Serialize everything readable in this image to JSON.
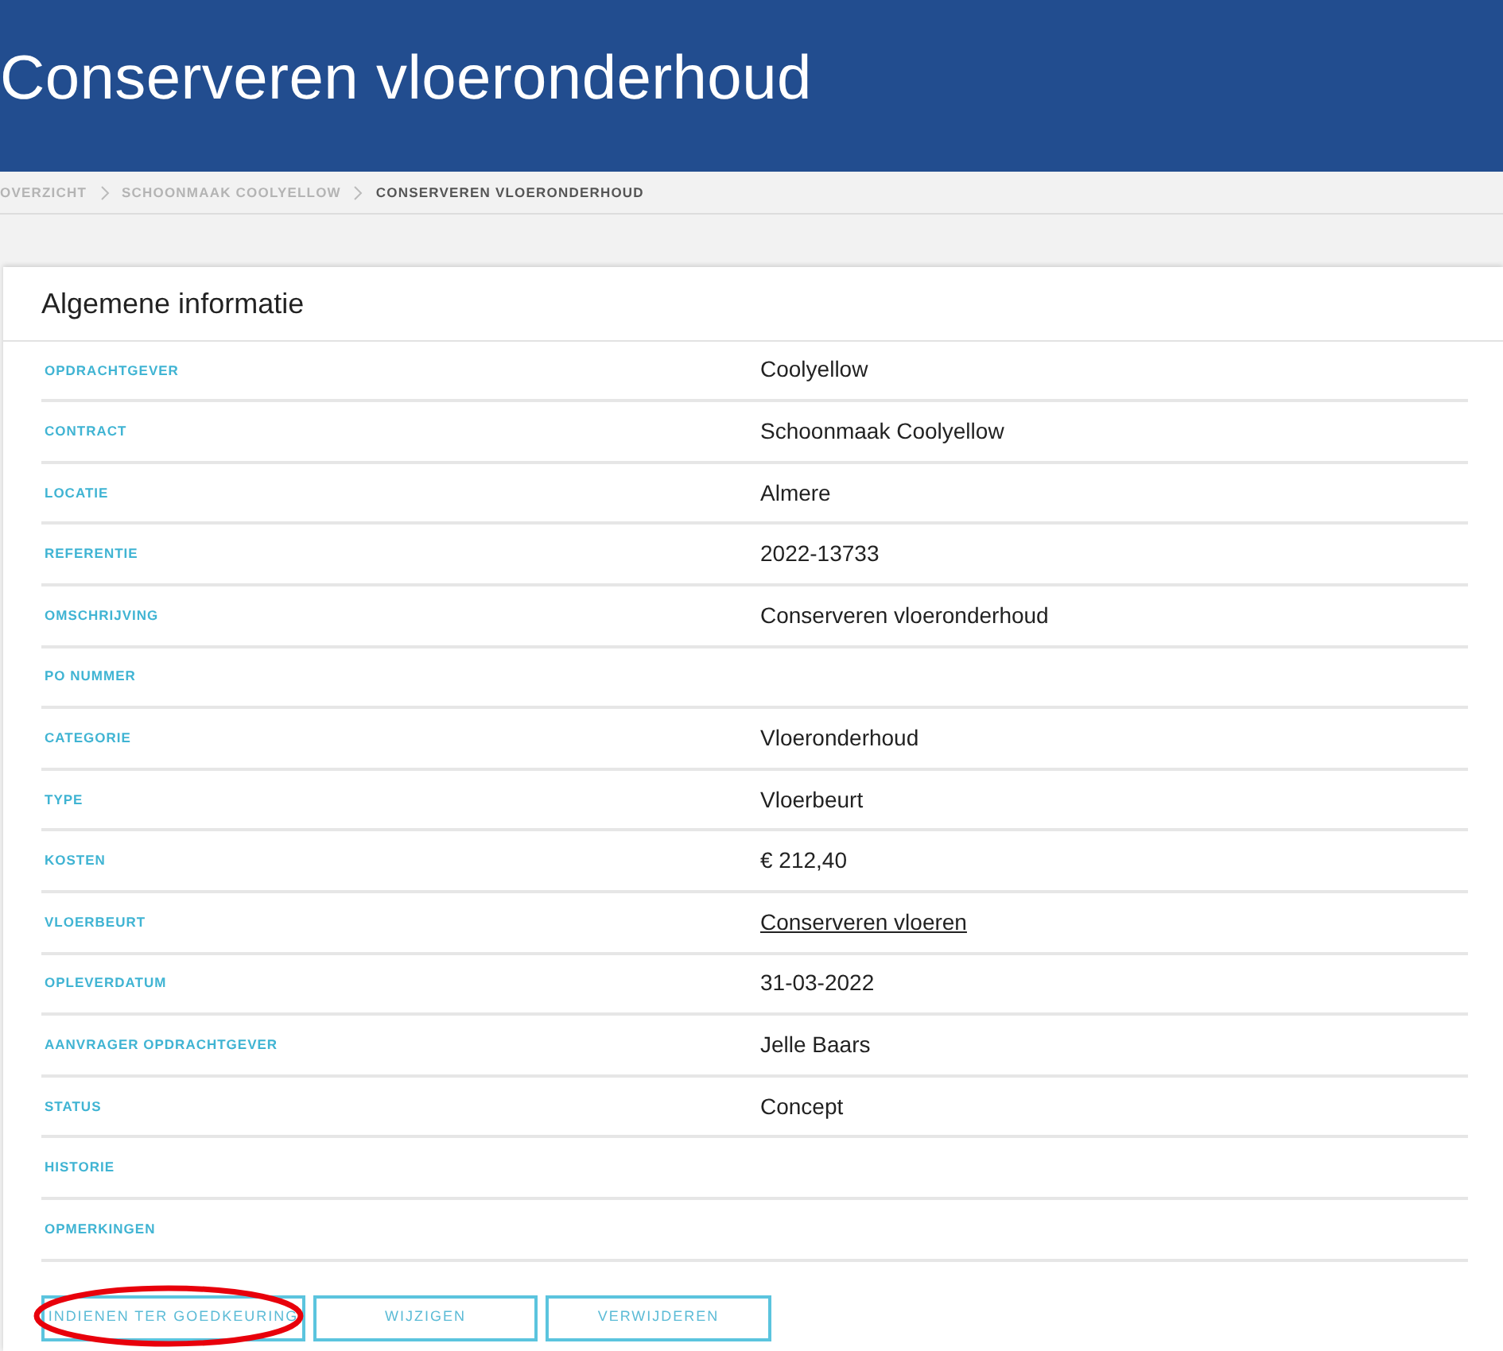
{
  "header": {
    "title": "Conserveren vloeronderhoud"
  },
  "breadcrumb": [
    {
      "label": "OVERZICHT",
      "current": false
    },
    {
      "label": "SCHOONMAAK COOLYELLOW",
      "current": false
    },
    {
      "label": "CONSERVEREN VLOERONDERHOUD",
      "current": true
    }
  ],
  "card": {
    "title": "Algemene informatie",
    "fields": [
      {
        "label": "OPDRACHTGEVER",
        "value": "Coolyellow",
        "kind": "text"
      },
      {
        "label": "CONTRACT",
        "value": "Schoonmaak Coolyellow",
        "kind": "text"
      },
      {
        "label": "LOCATIE",
        "value": "Almere",
        "kind": "text"
      },
      {
        "label": "REFERENTIE",
        "value": "2022-13733",
        "kind": "text"
      },
      {
        "label": "OMSCHRIJVING",
        "value": "Conserveren vloeronderhoud",
        "kind": "text"
      },
      {
        "label": "PO NUMMER",
        "kind": "text"
      },
      {
        "label": "CATEGORIE",
        "value": "Vloeronderhoud",
        "kind": "text"
      },
      {
        "label": "TYPE",
        "value": "Vloerbeurt",
        "kind": "text"
      },
      {
        "label": "KOSTEN",
        "value": "€ 212,40",
        "kind": "text"
      },
      {
        "label": "VLOERBEURT",
        "value": "Conserveren vloeren",
        "kind": "link"
      },
      {
        "label": "OPLEVERDATUM",
        "value": "31-03-2022",
        "kind": "text"
      },
      {
        "label": "AANVRAGER OPDRACHTGEVER",
        "value": "Jelle Baars",
        "kind": "text"
      },
      {
        "label": "STATUS",
        "value": "Concept",
        "kind": "text"
      },
      {
        "label": "HISTORIE",
        "kind": "text"
      },
      {
        "label": "OPMERKINGEN",
        "kind": "text"
      }
    ],
    "buttons": [
      {
        "label": "INDIENEN TER GOEDKEURING",
        "circled": true
      },
      {
        "label": "WIJZIGEN",
        "circled": false
      },
      {
        "label": "VERWIJDEREN",
        "circled": false
      }
    ]
  }
}
